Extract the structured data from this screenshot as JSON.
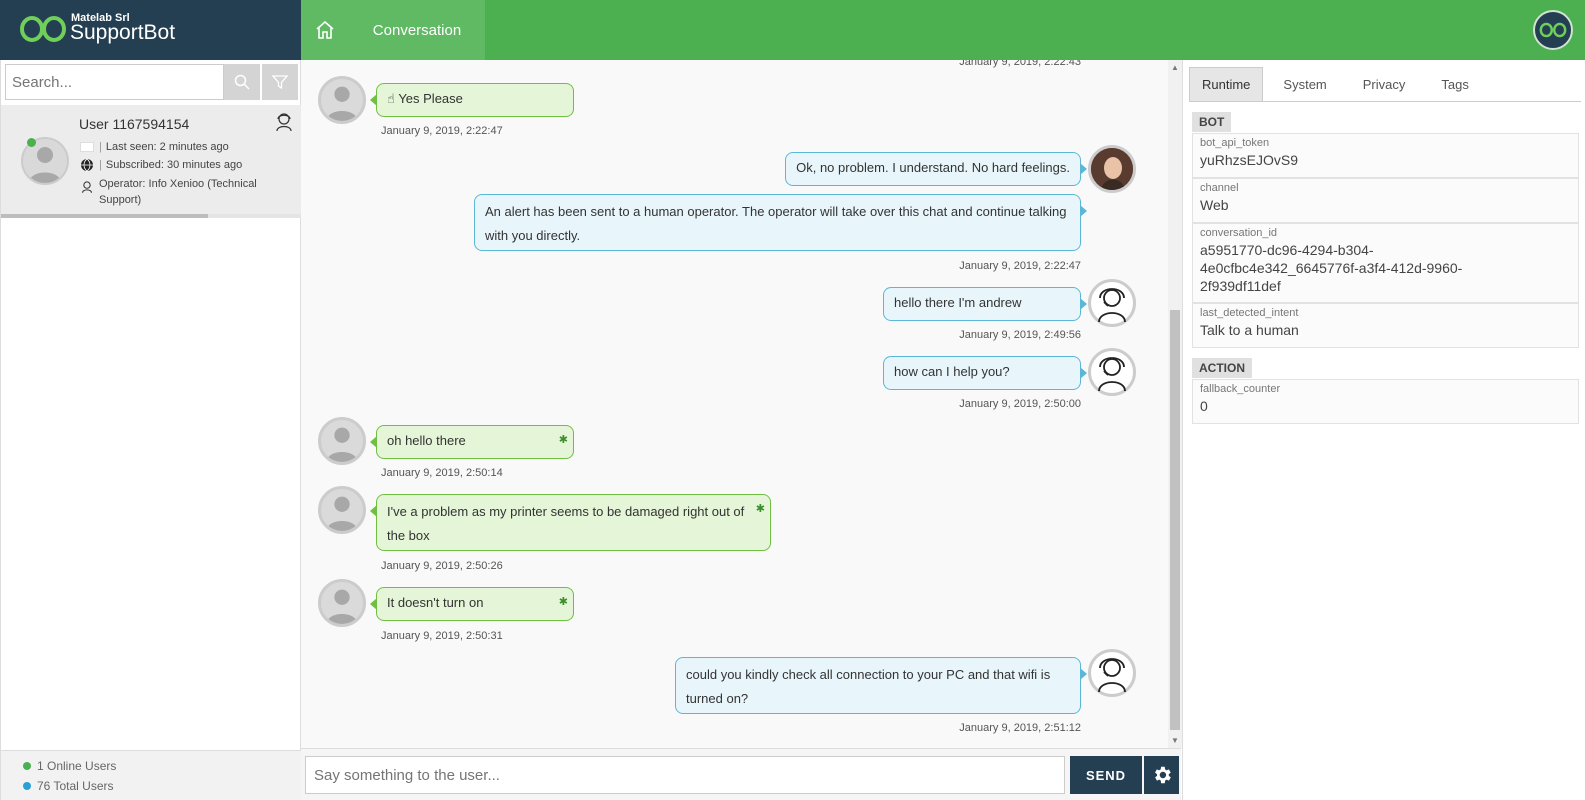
{
  "header": {
    "company": "Matelab Srl",
    "product": "SupportBot",
    "tab_label": "Conversation",
    "colors": {
      "brand_bg": "#253f52",
      "accent": "#4caf50"
    }
  },
  "sidebar": {
    "search_placeholder": "Search...",
    "user": {
      "name": "User 1167594154",
      "last_seen": "Last seen: 2 minutes ago",
      "subscribed": "Subscribed: 30 minutes ago",
      "operator_line1": "Operator: Info Xenioo (Technical",
      "operator_line2": "Support)",
      "progress": 0.69
    },
    "stats": {
      "online": "1 Online Users",
      "total": "76 Total Users"
    }
  },
  "chat": {
    "messages": [
      {
        "ts": "January 9, 2019, 2:22:43"
      },
      {
        "text": "Yes Please",
        "ts": "January 9, 2019, 2:22:47"
      },
      {
        "text": "Ok, no problem. I understand. No hard feelings."
      },
      {
        "text_line1": "An alert has been sent to a human operator. The operator will take over this chat and continue talking",
        "text_line2": "with you directly.",
        "ts": "January 9, 2019, 2:22:47"
      },
      {
        "text": "hello there I'm andrew",
        "ts": "January 9, 2019, 2:49:56"
      },
      {
        "text": "how can I help you?",
        "ts": "January 9, 2019, 2:50:00"
      },
      {
        "text": "oh hello there",
        "ts": "January 9, 2019, 2:50:14"
      },
      {
        "text_line1": "I've a problem as my printer seems to be damaged right out of",
        "text_line2": "the box",
        "ts": "January 9, 2019, 2:50:26"
      },
      {
        "text": "It doesn't turn on",
        "ts": "January 9, 2019, 2:50:31"
      },
      {
        "text_line1": "could you kindly check all connection to your PC and that wifi is",
        "text_line2": "turned on?",
        "ts": "January 9, 2019, 2:51:12"
      }
    ]
  },
  "composer": {
    "placeholder": "Say something to the user...",
    "send_label": "SEND"
  },
  "panel": {
    "tabs": [
      "Runtime",
      "System",
      "Privacy",
      "Tags"
    ],
    "bot_section": "BOT",
    "bot_vars": [
      {
        "key": "bot_api_token",
        "value": "yuRhzsEJOvS9"
      },
      {
        "key": "channel",
        "value": "Web"
      },
      {
        "key": "conversation_id",
        "value_line1": "a5951770-dc96-4294-b304-",
        "value_line2": "4e0cfbc4e342_6645776f-a3f4-412d-9960-",
        "value_line3": "2f939df11def"
      },
      {
        "key": "last_detected_intent",
        "value": "Talk to a human"
      }
    ],
    "action_section": "ACTION",
    "action_vars": [
      {
        "key": "fallback_counter",
        "value": "0"
      }
    ]
  }
}
